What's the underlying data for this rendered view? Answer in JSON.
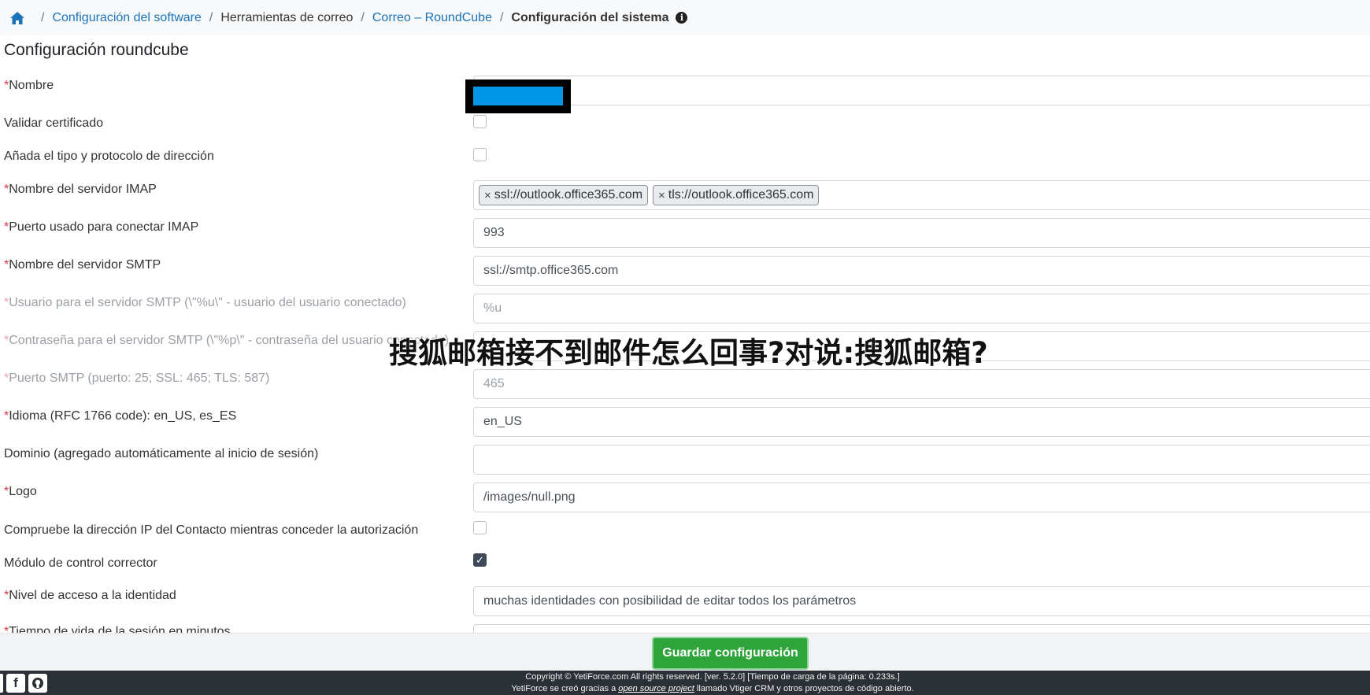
{
  "breadcrumb": {
    "items": [
      {
        "label": "Configuración del software",
        "link": true
      },
      {
        "label": "Herramientas de correo",
        "link": false
      },
      {
        "label": "Correo – RoundCube",
        "link": true
      },
      {
        "label": "Configuración del sistema",
        "current": true
      }
    ],
    "info_icon": "info-circle-icon"
  },
  "section_title": "Configuración roundcube",
  "fields": {
    "nombre": {
      "label": "Nombre",
      "required": true,
      "value": ""
    },
    "validar": {
      "label": "Validar certificado",
      "checked": false
    },
    "anada": {
      "label": "Añada el tipo y protocolo de dirección",
      "checked": false
    },
    "imap_server": {
      "label": "Nombre del servidor IMAP",
      "required": true,
      "tags": [
        "ssl://outlook.office365.com",
        "tls://outlook.office365.com"
      ],
      "remove_glyph": "×"
    },
    "imap_port": {
      "label": "Puerto usado para conectar IMAP",
      "required": true,
      "value": "993"
    },
    "smtp_server": {
      "label": "Nombre del servidor SMTP",
      "required": true,
      "value": "ssl://smtp.office365.com"
    },
    "smtp_user": {
      "label": "Usuario para el servidor SMTP (\\\"%u\\\" - usuario del usuario conectado)",
      "required": true,
      "placeholder": "%u"
    },
    "smtp_pass": {
      "label": "Contraseña para el servidor SMTP (\\\"%p\\\" - contraseña del usuario conectado)",
      "required": true,
      "value": ""
    },
    "smtp_port": {
      "label": "Puerto SMTP (puerto: 25; SSL: 465; TLS: 587)",
      "required": true,
      "placeholder": "465"
    },
    "idioma": {
      "label": "Idioma (RFC 1766 code): en_US, es_ES",
      "required": true,
      "value": "en_US"
    },
    "dominio": {
      "label": "Dominio (agregado automáticamente al inicio de sesión)",
      "value": ""
    },
    "logo": {
      "label": "Logo",
      "required": true,
      "value": "/images/null.png"
    },
    "ip_check": {
      "label": "Compruebe la dirección IP del Contacto mientras conceder la autorización",
      "checked": false
    },
    "corrector": {
      "label": "Módulo de control corrector",
      "checked": true
    },
    "identidad": {
      "label": "Nivel de acceso a la identidad",
      "required": true,
      "value": "muchas identidades con posibilidad de editar todos los parámetros"
    },
    "partial": {
      "label": "Tiempo de vida de la sesión en minutos",
      "required": true,
      "value": ""
    }
  },
  "overlay_text": "搜狐邮箱接不到邮件怎么回事?对说:搜狐邮箱?",
  "save_button": "Guardar configuración",
  "footer": {
    "line1": "Copyright © YetiForce.com All rights reserved. [ver. 5.2.0] [Tiempo de carga de la página: 0.233s.]",
    "line2_pre": "YetiForce se creó gracias a ",
    "line2_link": "open source project",
    "line2_post": " llamado Vtiger CRM y otros proyectos de código abierto.",
    "social_icons": [
      "facebook-icon",
      "github-icon"
    ]
  },
  "colors": {
    "link": "#1a73b8",
    "required": "#dc3545",
    "save": "#2ea43a",
    "footer_bg": "#2b3036",
    "redact_blue": "#0096e6"
  }
}
